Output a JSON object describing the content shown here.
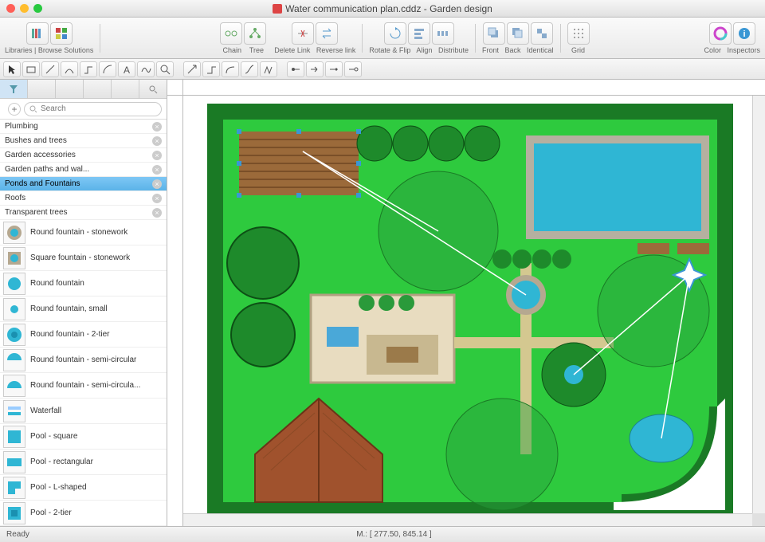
{
  "window": {
    "title": "Water communication plan.cddz - Garden design"
  },
  "toolbar": {
    "libraries": "Libraries",
    "browse": "Browse Solutions",
    "chain": "Chain",
    "tree": "Tree",
    "delete": "Delete Link",
    "reverse": "Reverse link",
    "rotate": "Rotate & Flip",
    "align": "Align",
    "distribute": "Distribute",
    "front": "Front",
    "back": "Back",
    "identical": "Identical",
    "grid": "Grid",
    "color": "Color",
    "inspectors": "Inspectors"
  },
  "search": {
    "placeholder": "Search"
  },
  "categories": [
    {
      "label": "Plumbing"
    },
    {
      "label": "Bushes and trees"
    },
    {
      "label": "Garden accessories"
    },
    {
      "label": "Garden paths and wal..."
    },
    {
      "label": "Ponds and Fountains",
      "selected": true
    },
    {
      "label": "Roofs"
    },
    {
      "label": "Transparent trees"
    }
  ],
  "items": [
    {
      "label": "Round fountain - stonework",
      "icon": "round-stone"
    },
    {
      "label": "Square fountain - stonework",
      "icon": "square-stone"
    },
    {
      "label": "Round fountain",
      "icon": "round"
    },
    {
      "label": "Round fountain, small",
      "icon": "round-small"
    },
    {
      "label": "Round fountain - 2-tier",
      "icon": "round-2tier"
    },
    {
      "label": "Round fountain - semi-circular",
      "icon": "semi"
    },
    {
      "label": "Round fountain - semi-circula...",
      "icon": "semi2"
    },
    {
      "label": "Waterfall",
      "icon": "waterfall"
    },
    {
      "label": "Pool - square",
      "icon": "pool-sq"
    },
    {
      "label": "Pool - rectangular",
      "icon": "pool-rect"
    },
    {
      "label": "Pool - L-shaped",
      "icon": "pool-l"
    },
    {
      "label": "Pool - 2-tier",
      "icon": "pool-2tier"
    }
  ],
  "status": {
    "ready": "Ready",
    "coords": "M.: [ 277.50, 845.14 ]"
  }
}
